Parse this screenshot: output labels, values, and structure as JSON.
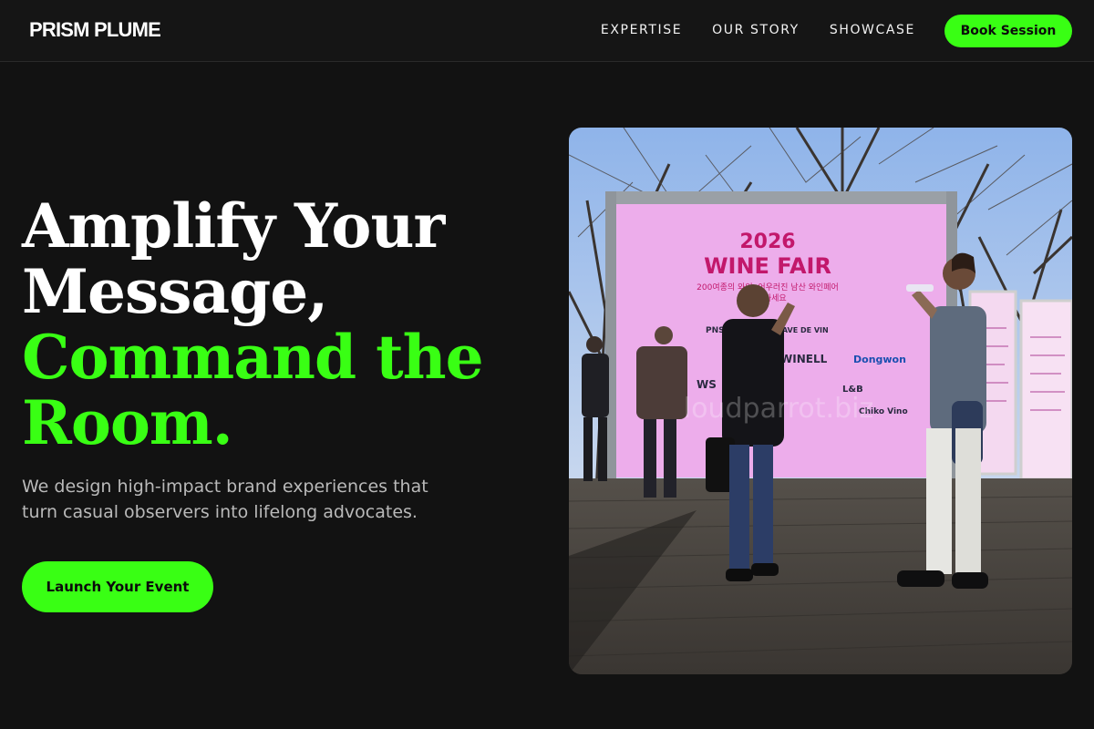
{
  "brand": {
    "name": "PRISM PLUME"
  },
  "nav": {
    "links": [
      "EXPERTISE",
      "OUR STORY",
      "SHOWCASE"
    ],
    "cta_label": "Book Session"
  },
  "hero": {
    "title_lines": [
      "Amplify Your",
      "Message,"
    ],
    "title_accent_lines": [
      "Command the",
      "Room."
    ],
    "subtitle": "We design high-impact brand experiences that turn casual observers into lifelong advocates.",
    "cta_label": "Launch Your Event"
  },
  "photo": {
    "banner_year": "2026",
    "banner_title": "WINE FAIR",
    "banner_korean": "200여종의 와인, 어우러진 남산 와인페어",
    "banner_korean_2": "함께하세요",
    "sponsors": [
      "PNS WINE",
      "CAVE DE VIN",
      "WINELL",
      "Dongwon",
      "WS",
      "L&B",
      "Chiko Vino"
    ],
    "watermark": "loudparrot.biz"
  },
  "colors": {
    "accent": "#39ff14",
    "background": "#121212",
    "text_muted": "#b9b9b9"
  }
}
